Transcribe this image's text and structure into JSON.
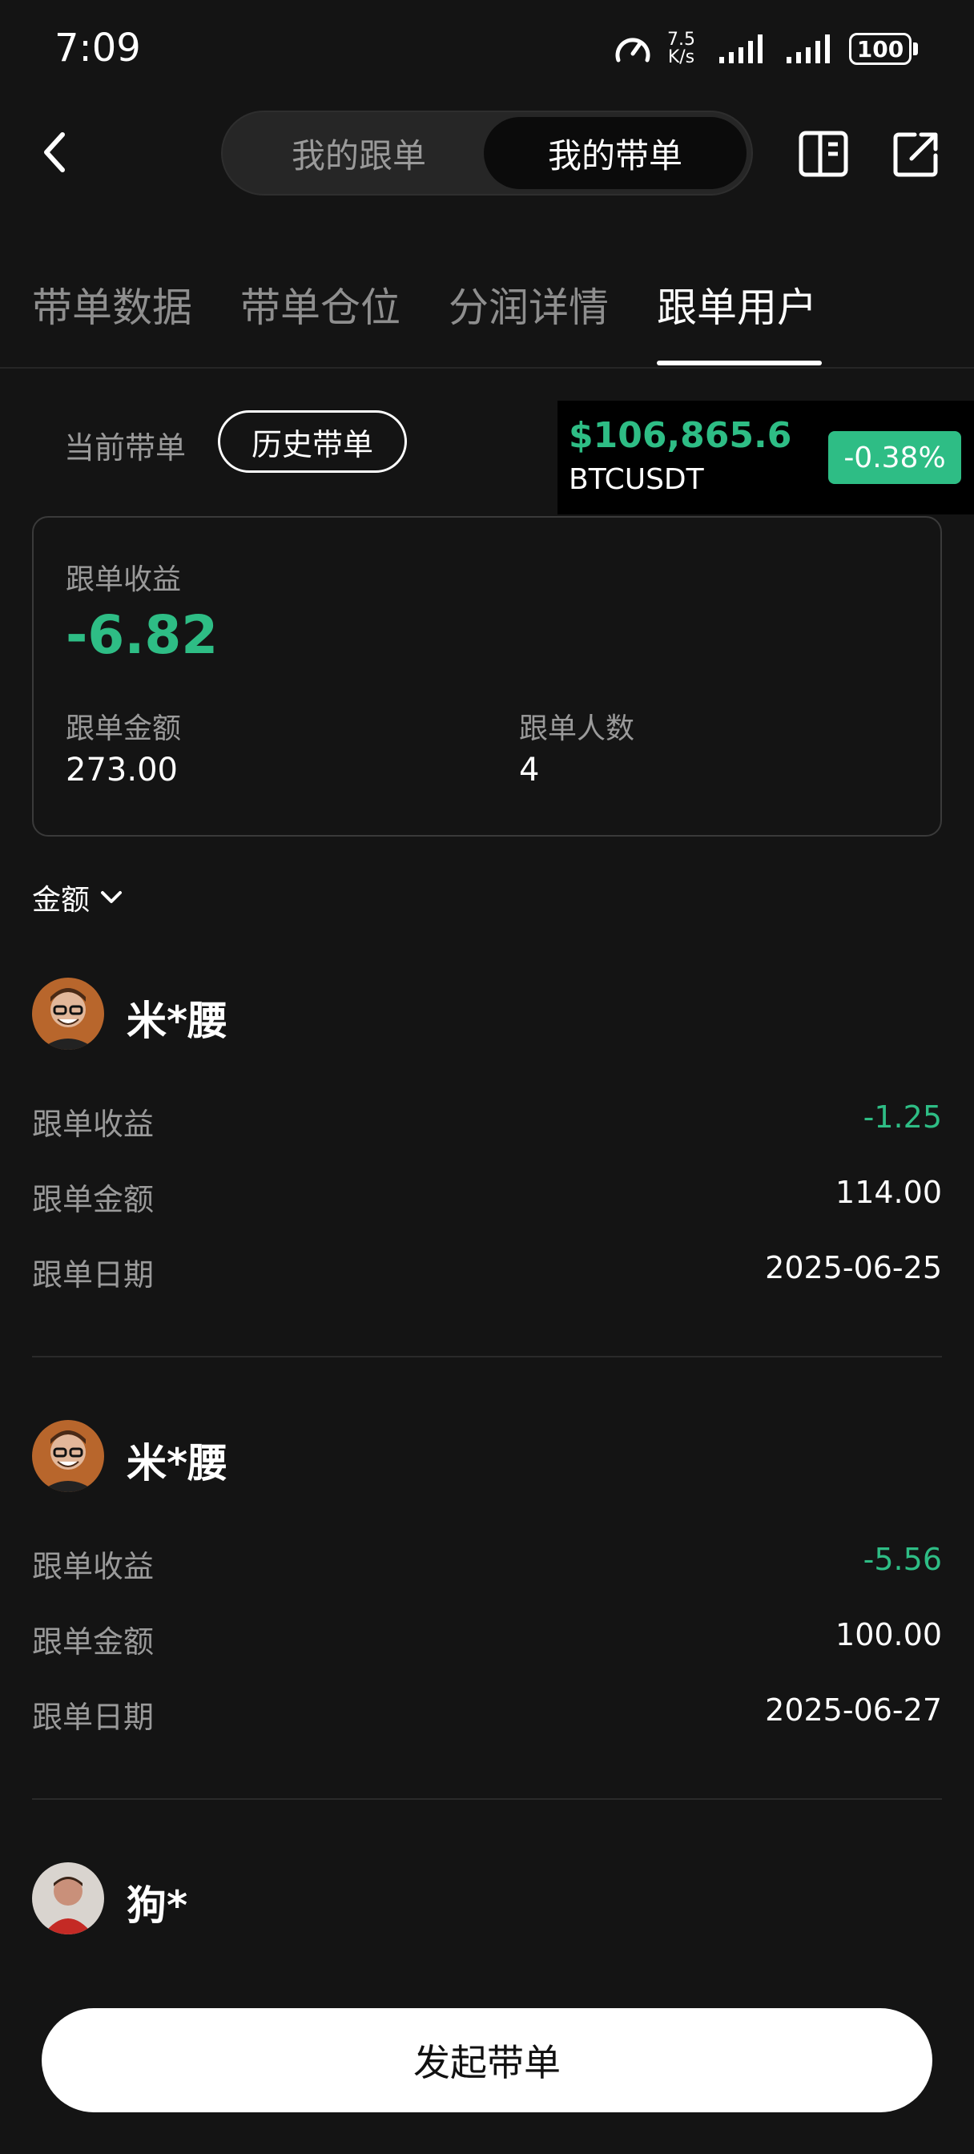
{
  "status_bar": {
    "time": "7:09",
    "net_speed_value": "7.5",
    "net_speed_unit": "K/s",
    "battery": "100"
  },
  "header": {
    "segments": [
      "我的跟单",
      "我的带单"
    ],
    "active_segment": "我的带单"
  },
  "main_tabs": [
    "带单数据",
    "带单仓位",
    "分润详情",
    "跟单用户"
  ],
  "active_tab": "跟单用户",
  "sub_tabs": {
    "current": "当前带单",
    "history": "历史带单"
  },
  "ticker": {
    "price": "$106,865.6",
    "symbol": "BTCUSDT",
    "change": "-0.38%"
  },
  "summary": {
    "profit_label": "跟单收益",
    "profit_value": "-6.82",
    "amount_label": "跟单金额",
    "amount_value": "273.00",
    "count_label": "跟单人数",
    "count_value": "4"
  },
  "sort": {
    "label": "金额",
    "icon": "chevron-down-icon"
  },
  "entries": [
    {
      "name": "米*腰",
      "profit_label": "跟单收益",
      "profit": "-1.25",
      "amount_label": "跟单金额",
      "amount": "114.00",
      "date_label": "跟单日期",
      "date": "2025-06-25"
    },
    {
      "name": "米*腰",
      "profit_label": "跟单收益",
      "profit": "-5.56",
      "amount_label": "跟单金额",
      "amount": "100.00",
      "date_label": "跟单日期",
      "date": "2025-06-27"
    },
    {
      "name": "狗*"
    }
  ],
  "bottom_button": "发起带单",
  "colors": {
    "background": "#141414",
    "green": "#2ebd85",
    "muted": "#9a9a9a",
    "button_bg": "#ffffff"
  }
}
